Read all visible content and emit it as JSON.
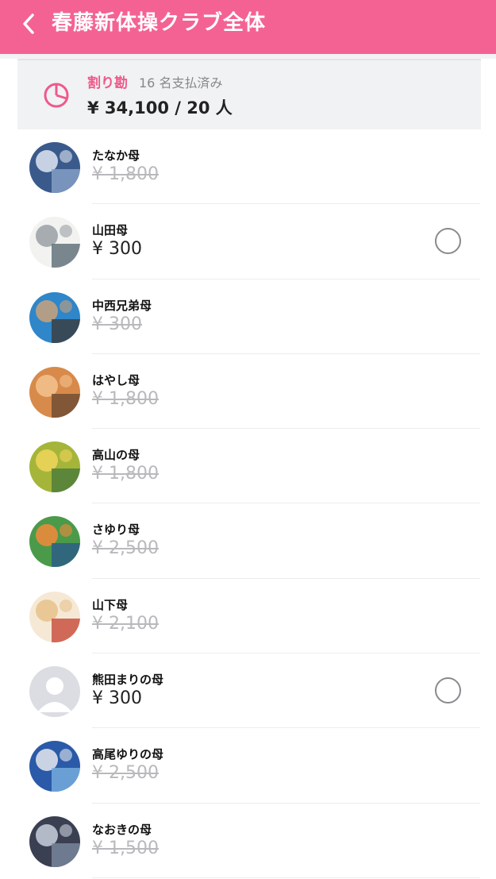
{
  "header": {
    "title": "春藤新体操クラブ全体",
    "back_icon": "chevron-left-icon"
  },
  "summary": {
    "tag": "割り勘",
    "paid_status": "16 名支払済み",
    "total": "¥ 34,100 / 20 人",
    "icon": "pie-chart-icon"
  },
  "members": [
    {
      "name": "たなか母",
      "amount": "¥ 1,800",
      "paid": true
    },
    {
      "name": "山田母",
      "amount": "¥ 300",
      "paid": false
    },
    {
      "name": "中西兄弟母",
      "amount": "¥ 300",
      "paid": true
    },
    {
      "name": "はやし母",
      "amount": "¥ 1,800",
      "paid": true
    },
    {
      "name": "高山の母",
      "amount": "¥ 1,800",
      "paid": true
    },
    {
      "name": "さゆり母",
      "amount": "¥ 2,500",
      "paid": true
    },
    {
      "name": "山下母",
      "amount": "¥ 2,100",
      "paid": true
    },
    {
      "name": "熊田まりの母",
      "amount": "¥ 300",
      "paid": false
    },
    {
      "name": "高尾ゆりの母",
      "amount": "¥ 2,500",
      "paid": true
    },
    {
      "name": "なおきの母",
      "amount": "¥ 1,500",
      "paid": true
    }
  ],
  "colors": {
    "accent": "#f46293",
    "paid_text": "#b9b9bd"
  }
}
